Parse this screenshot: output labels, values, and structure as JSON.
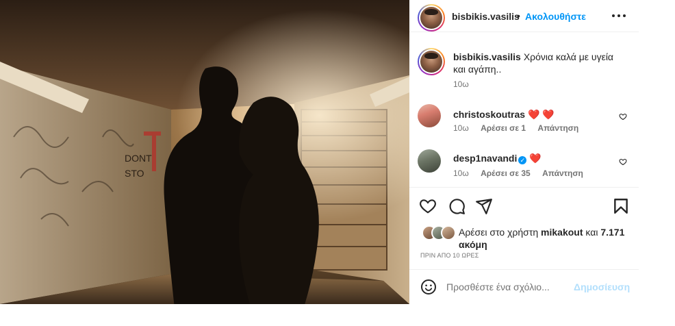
{
  "header": {
    "username": "bisbikis.vasilis",
    "separator": "•",
    "follow_label": "Ακολουθήστε",
    "more_icon": "more-horizontal-icon"
  },
  "caption": {
    "username": "bisbikis.vasilis",
    "text": "Χρόνια καλά με υγεία και αγάπη..",
    "time": "10ω"
  },
  "comments": [
    {
      "username": "christoskoutras",
      "text": "❤️ ❤️",
      "time": "10ω",
      "likes": "Αρέσει σε 1",
      "reply_label": "Απάντηση",
      "verified": false
    },
    {
      "username": "desp1navandi",
      "text": "❤️",
      "time": "10ω",
      "likes": "Αρέσει σε 35",
      "reply_label": "Απάντηση",
      "verified": true
    }
  ],
  "actions": {
    "like_icon": "heart-icon",
    "comment_icon": "comment-icon",
    "share_icon": "share-icon",
    "save_icon": "bookmark-icon"
  },
  "likes": {
    "prefix": "Αρέσει στο χρήστη",
    "user": "mikakout",
    "conj": "και",
    "count": "7.171",
    "suffix": "ακόμη"
  },
  "timestamp": "ΠΡΙΝ ΑΠΟ 10 ΩΡΕΣ",
  "add_comment": {
    "placeholder": "Προσθέστε ένα σχόλιο...",
    "post_label": "Δημοσίευση"
  },
  "colors": {
    "link_blue": "#0095f6",
    "post_disabled": "#b2dffc",
    "heart_red": "#e0245e",
    "text": "#262626",
    "muted": "#737373"
  }
}
